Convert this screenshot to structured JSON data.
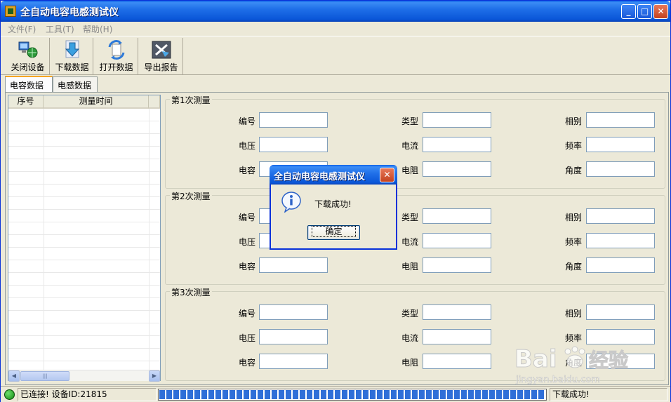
{
  "window": {
    "title": "全自动电容电感测试仪"
  },
  "menu": [
    {
      "label": "文件(F)"
    },
    {
      "label": "工具(T)"
    },
    {
      "label": "帮助(H)"
    }
  ],
  "toolbar": [
    {
      "label": "关闭设备",
      "icon": "network-computer-icon"
    },
    {
      "label": "下载数据",
      "icon": "download-arrow-icon"
    },
    {
      "label": "打开数据",
      "icon": "open-data-icon"
    },
    {
      "label": "导出报告",
      "icon": "export-report-icon"
    }
  ],
  "tabs": [
    {
      "label": "电容数据",
      "active": true
    },
    {
      "label": "电感数据",
      "active": false
    }
  ],
  "list": {
    "columns": [
      "序号",
      "测量时间"
    ]
  },
  "groups": [
    {
      "title": "第1次测量",
      "fields": {
        "c1": [
          "编号",
          "电压",
          "电容"
        ],
        "c2": [
          "类型",
          "电流",
          "电阻"
        ],
        "c3": [
          "相别",
          "频率",
          "角度"
        ]
      }
    },
    {
      "title": "第2次测量",
      "fields": {
        "c1": [
          "编号",
          "电压",
          "电容"
        ],
        "c2": [
          "类型",
          "电流",
          "电阻"
        ],
        "c3": [
          "相别",
          "频率",
          "角度"
        ]
      }
    },
    {
      "title": "第3次测量",
      "fields": {
        "c1": [
          "编号",
          "电压",
          "电容"
        ],
        "c2": [
          "类型",
          "电流",
          "电阻"
        ],
        "c3": [
          "相别",
          "频率",
          "角度"
        ]
      }
    }
  ],
  "dialog": {
    "title": "全自动电容电感测试仪",
    "message": "下载成功!",
    "ok_label": "确定"
  },
  "status": {
    "connection": "已连接! 设备ID:21815",
    "progress": 1.0,
    "message": "下载成功!"
  },
  "watermark": {
    "brand": "Bai",
    "brand_suffix": "经验",
    "url": "jingyan.baidu.com"
  },
  "colors": {
    "titlebar": "#0a56d8",
    "progress": "#2f6fd8",
    "led": "#108a10"
  }
}
